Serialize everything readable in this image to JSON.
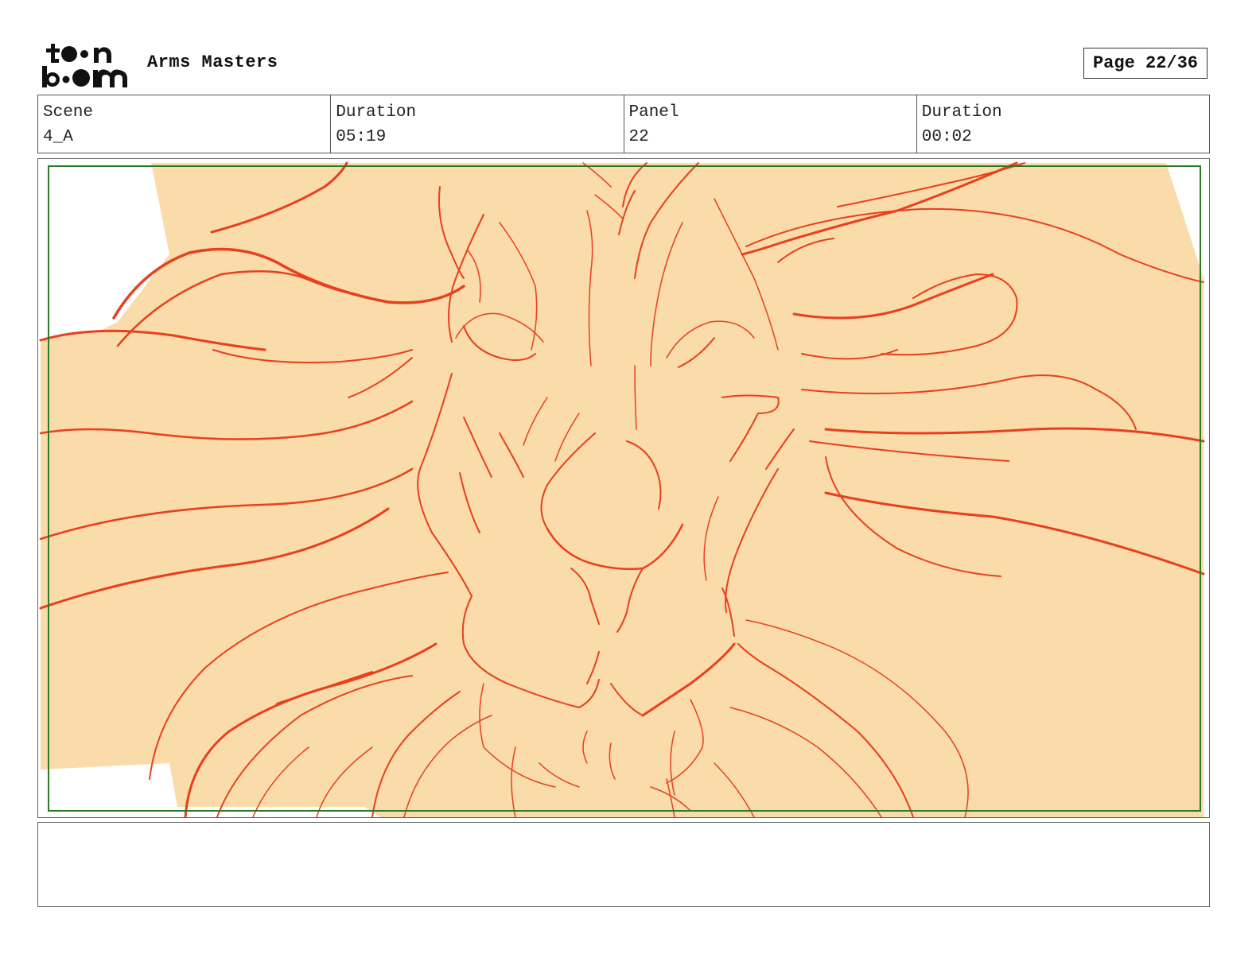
{
  "header": {
    "logo_text": "toon boom",
    "project_title": "Arms Masters",
    "page_label": "Page 22/36"
  },
  "info": [
    {
      "label": "Scene",
      "value": "4_A"
    },
    {
      "label": "Duration",
      "value": "05:19"
    },
    {
      "label": "Panel",
      "value": "22"
    },
    {
      "label": "Duration",
      "value": "00:02"
    }
  ],
  "panel": {
    "fill_color": "#fadbaa",
    "line_color": "#e8401c",
    "safe_frame_color": "#2a7a2a",
    "drawing_subject": "lion-face-sketch"
  },
  "notes": {
    "text": ""
  }
}
